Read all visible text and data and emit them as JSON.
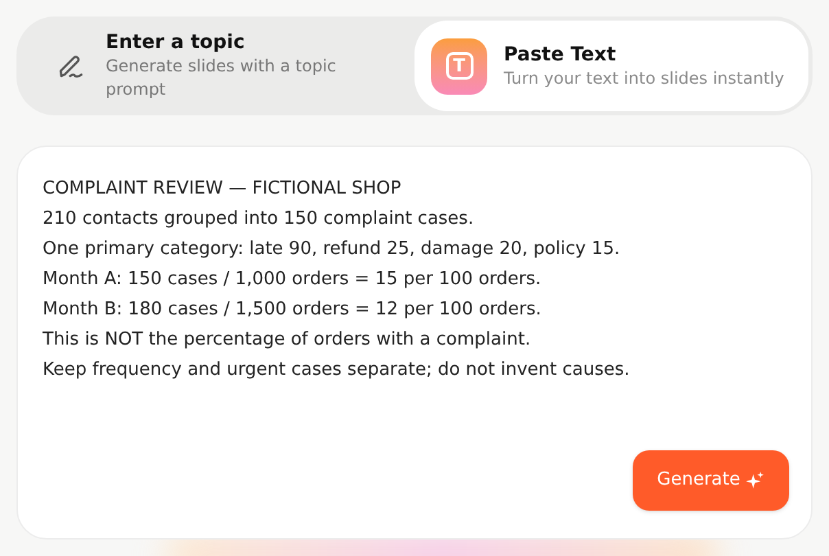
{
  "tabs": [
    {
      "kind": "pen",
      "title": "Enter a topic",
      "subtitle": "Generate slides with a topic prompt",
      "selected": false
    },
    {
      "kind": "letter",
      "icon_letter": "T",
      "title": "Paste Text",
      "subtitle": "Turn your text into slides instantly",
      "selected": true
    }
  ],
  "editor": {
    "lines": [
      "COMPLAINT REVIEW — FICTIONAL SHOP",
      "210 contacts grouped into 150 complaint cases.",
      "One primary category: late 90, refund 25, damage 20, policy 15.",
      "Month A: 150 cases / 1,000 orders = 15 per 100 orders.",
      "Month B: 180 cases / 1,500 orders = 12 per 100 orders.",
      "This is NOT the percentage of orders with a complaint.",
      "Keep frequency and urgent cases separate; do not invent causes."
    ]
  },
  "generate_button": {
    "label": "Generate"
  }
}
